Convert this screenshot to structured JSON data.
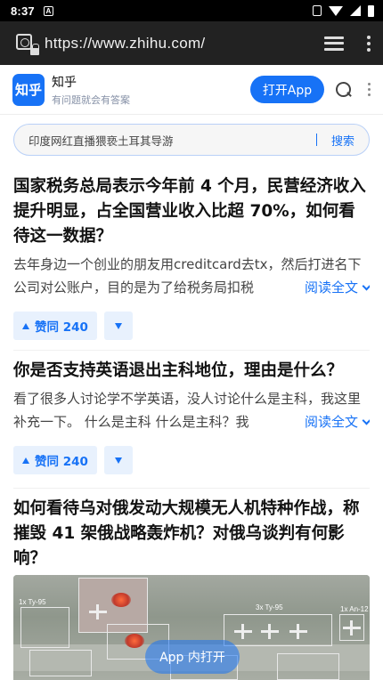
{
  "status_bar": {
    "time": "8:37",
    "notification_badge": "A"
  },
  "browser": {
    "url": "https://www.zhihu.com/"
  },
  "header": {
    "logo_text": "知乎",
    "brand_name": "知乎",
    "slogan": "有问题就会有答案",
    "open_app_label": "打开App"
  },
  "search": {
    "query": "印度网红直播猥亵土耳其导游",
    "button_label": "搜索"
  },
  "feed": [
    {
      "title": "国家税务总局表示今年前 4 个月，民营经济收入提升明显，占全国营业收入比超 70%，如何看待这一数据？",
      "excerpt": "去年身边一个创业的朋友用creditcard去tx，然后打进名下公司对公账户，目的是为了给税务局扣税",
      "read_more": "阅读全文",
      "vote_label": "赞同 240"
    },
    {
      "title": "你是否支持英语退出主科地位，理由是什么？",
      "excerpt": "看了很多人讨论学不学英语，没人讨论什么是主科，我这里补充一下。 什么是主科 什么是主科？我",
      "read_more": "阅读全文",
      "vote_label": "赞同 240"
    },
    {
      "title": "如何看待乌对俄发动大规模无人机特种作战，称摧毁 41 架俄战略轰炸机？对俄乌谈判有何影响？",
      "image_labels": [
        "1x Ty-95",
        "3x Ty-95",
        "1x An-12"
      ]
    }
  ],
  "floating": {
    "open_in_app_label": "App 内打开"
  },
  "colors": {
    "brand_blue": "#1772f6",
    "vote_bg": "#e8f1fd"
  }
}
